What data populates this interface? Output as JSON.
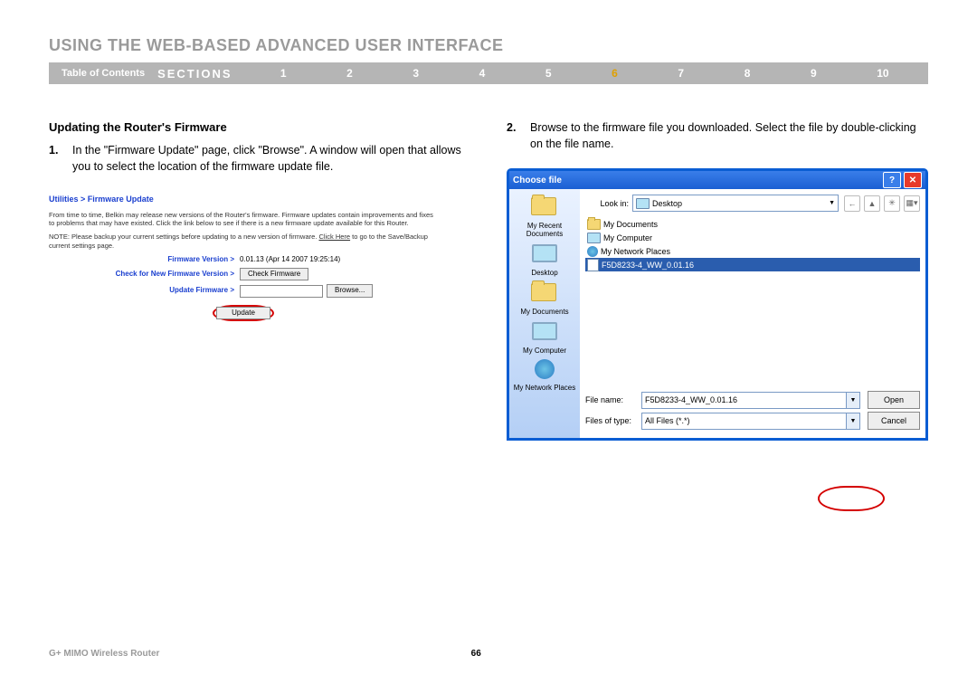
{
  "title": "USING THE WEB-BASED ADVANCED USER INTERFACE",
  "nav": {
    "toc": "Table of Contents",
    "sections": "SECTIONS",
    "items": [
      "1",
      "2",
      "3",
      "4",
      "5",
      "6",
      "7",
      "8",
      "9",
      "10"
    ],
    "active": "6"
  },
  "subheading": "Updating the Router's Firmware",
  "steps": {
    "1": {
      "num": "1.",
      "text": "In the \"Firmware Update\" page, click \"Browse\". A window will open that allows you to select the location of the firmware update file."
    },
    "2": {
      "num": "2.",
      "text": "Browse to the firmware file you downloaded. Select the file by double-clicking on the file name."
    }
  },
  "util": {
    "crumb": "Utilities > Firmware Update",
    "p1": "From time to time, Belkin may release new versions of the Router's firmware. Firmware updates contain improvements and fixes to problems that may have existed. Click the link below to see if there is a new firmware update available for this Router.",
    "p2a": "NOTE: Please backup your current settings before updating to a new version of firmware. ",
    "p2link": "Click Here",
    "p2b": " to go to the Save/Backup current settings page.",
    "rows": {
      "fw": {
        "label": "Firmware Version >",
        "value": "0.01.13 (Apr 14 2007 19:25:14)"
      },
      "check": {
        "label": "Check for New Firmware Version >",
        "btn": "Check Firmware"
      },
      "update": {
        "label": "Update Firmware >",
        "btn": "Browse..."
      },
      "submit": "Update"
    }
  },
  "dialog": {
    "title": "Choose file",
    "lookin_label": "Look in:",
    "lookin_value": "Desktop",
    "sidebar": [
      "My Recent Documents",
      "Desktop",
      "My Documents",
      "My Computer",
      "My Network Places"
    ],
    "files": {
      "0": "My Documents",
      "1": "My Computer",
      "2": "My Network Places",
      "3": "F5D8233-4_WW_0.01.16"
    },
    "filename_label": "File name:",
    "filename_value": "F5D8233-4_WW_0.01.16",
    "filetype_label": "Files of type:",
    "filetype_value": "All Files (*.*)",
    "open": "Open",
    "cancel": "Cancel"
  },
  "footer": {
    "product": "G+ MIMO Wireless Router",
    "page": "66"
  }
}
